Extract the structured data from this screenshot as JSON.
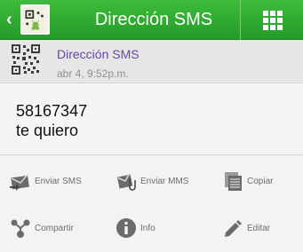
{
  "app_bar": {
    "title": "Dirección SMS",
    "back_icon": "chevron-left-icon",
    "menu_icon": "grid-icon",
    "color": "#2fa832"
  },
  "message": {
    "title": "Dirección SMS",
    "timestamp": "abr 4, 9:52p.m.",
    "lines": [
      "58167347",
      "te quiero"
    ]
  },
  "actions": {
    "send_sms": "Enviar SMS",
    "send_mms": "Enviar MMS",
    "copy": "Copiar",
    "share": "Compartir",
    "info": "Info",
    "edit": "Editar"
  },
  "colors": {
    "title_purple": "#6546a8",
    "icon_gray": "#6b6b6b"
  }
}
